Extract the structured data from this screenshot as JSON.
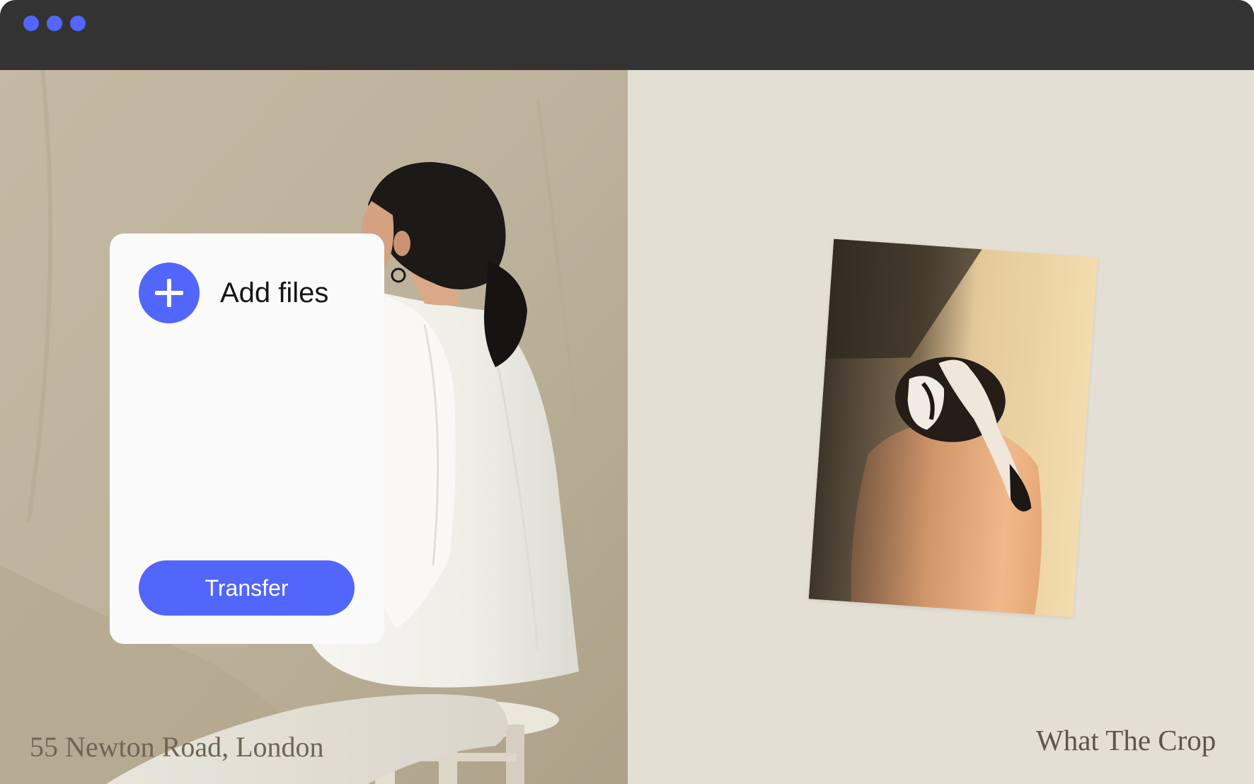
{
  "window": {
    "controls": [
      "close",
      "minimize",
      "maximize"
    ],
    "accent_color": "#5266fb",
    "titlebar_color": "#333333"
  },
  "upload": {
    "add_files_label": "Add files",
    "add_icon": "plus-icon",
    "transfer_label": "Transfer"
  },
  "left_panel": {
    "address": "55 Newton Road, London"
  },
  "right_panel": {
    "brand": "What The Crop",
    "background_color": "#e4dfd5"
  }
}
